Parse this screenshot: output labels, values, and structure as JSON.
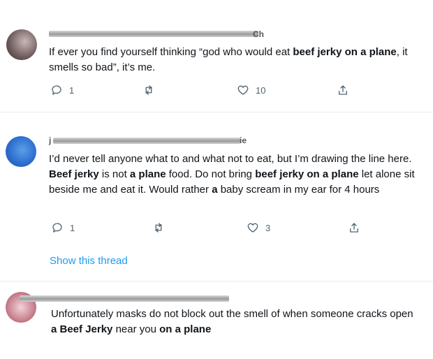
{
  "tweets": [
    {
      "name_tail": "Ch",
      "text_parts": [
        {
          "t": "If ever you find yourself thinking “god who would eat "
        },
        {
          "t": "beef jerky on a plane",
          "b": true
        },
        {
          "t": ", it smells so bad”, it’s me."
        }
      ],
      "replies": "1",
      "retweets": "",
      "likes": "10"
    },
    {
      "name_head": "j",
      "name_tail": "ie",
      "text_parts": [
        {
          "t": "I’d never tell anyone what to and what not to eat, but I’m drawing the line here. "
        },
        {
          "t": "Beef jerky",
          "b": true
        },
        {
          "t": " is not "
        },
        {
          "t": "a plane",
          "b": true
        },
        {
          "t": " food. Do not bring "
        },
        {
          "t": "beef jerky on a plane",
          "b": true
        },
        {
          "t": " let alone sit beside me and eat it. Would rather "
        },
        {
          "t": "a",
          "b": true
        },
        {
          "t": " baby scream in my ear for 4 hours"
        }
      ],
      "replies": "1",
      "retweets": "",
      "likes": "3"
    },
    {
      "text_parts": [
        {
          "t": "Unfortunately masks do not block out the smell of when someone cracks open "
        },
        {
          "t": "a Beef Jerky",
          "b": true
        },
        {
          "t": " near you "
        },
        {
          "t": "on a plane",
          "b": true
        }
      ]
    }
  ],
  "show_thread_label": "Show this thread",
  "colors": {
    "link": "#1d9bf0",
    "muted": "#536471",
    "divider": "#e6ecf0"
  },
  "icons": [
    "reply-icon",
    "retweet-icon",
    "like-icon",
    "share-icon"
  ]
}
